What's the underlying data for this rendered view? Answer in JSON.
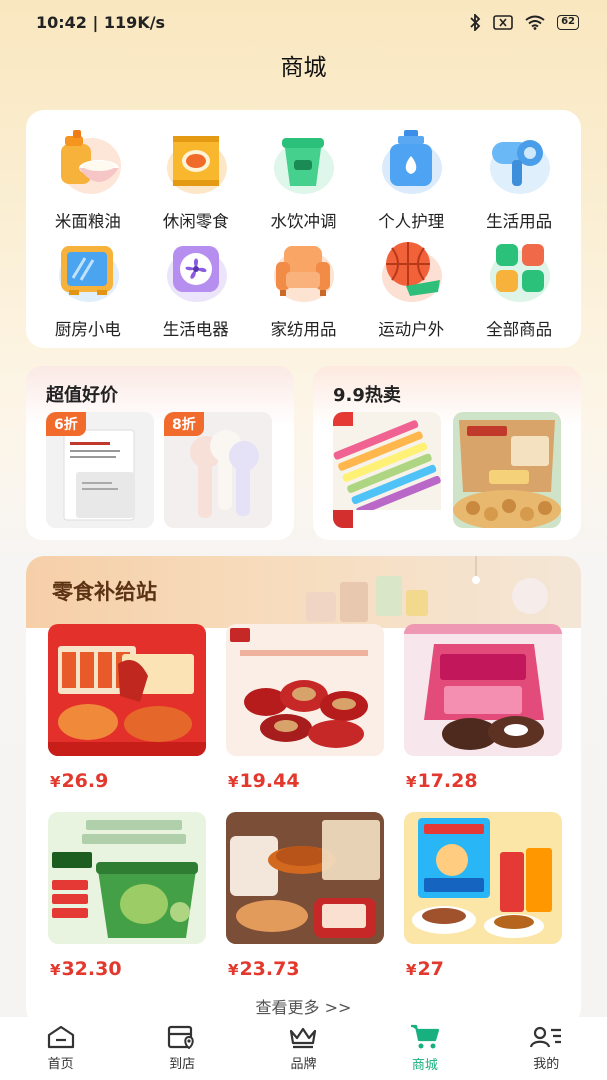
{
  "status_bar": {
    "time_speed": "10:42 | 119K/s",
    "battery": "62"
  },
  "header": {
    "title": "商城"
  },
  "categories": [
    {
      "label": "米面粮油",
      "icon": "rice-oil-icon"
    },
    {
      "label": "休闲零食",
      "icon": "snack-bag-icon"
    },
    {
      "label": "水饮冲调",
      "icon": "drink-cup-icon"
    },
    {
      "label": "个人护理",
      "icon": "lotion-bottle-icon"
    },
    {
      "label": "生活用品",
      "icon": "hair-dryer-icon"
    },
    {
      "label": "厨房小电",
      "icon": "microwave-icon"
    },
    {
      "label": "生活电器",
      "icon": "fan-icon"
    },
    {
      "label": "家纺用品",
      "icon": "sofa-icon"
    },
    {
      "label": "运动户外",
      "icon": "basketball-icon"
    },
    {
      "label": "全部商品",
      "icon": "all-grid-icon"
    }
  ],
  "promos": {
    "left": {
      "title": "超值好价",
      "items": [
        {
          "tag": "6折"
        },
        {
          "tag": "8折"
        }
      ]
    },
    "right": {
      "title": "9.9热卖"
    }
  },
  "snack_section": {
    "title": "零食补给站",
    "products": [
      {
        "price": "26.9"
      },
      {
        "price": "19.44"
      },
      {
        "price": "17.28"
      },
      {
        "price": "32.30"
      },
      {
        "price": "23.73"
      },
      {
        "price": "27"
      }
    ],
    "currency": "¥"
  },
  "see_more": "查看更多 >>",
  "nav": [
    {
      "label": "首页",
      "icon": "home-icon"
    },
    {
      "label": "到店",
      "icon": "store-location-icon"
    },
    {
      "label": "品牌",
      "icon": "crown-icon"
    },
    {
      "label": "商城",
      "icon": "cart-icon",
      "active": true
    },
    {
      "label": "我的",
      "icon": "profile-icon"
    }
  ],
  "colors": {
    "accent": "#19b07f",
    "price": "#e2382d",
    "discount": "#f16b2c"
  }
}
